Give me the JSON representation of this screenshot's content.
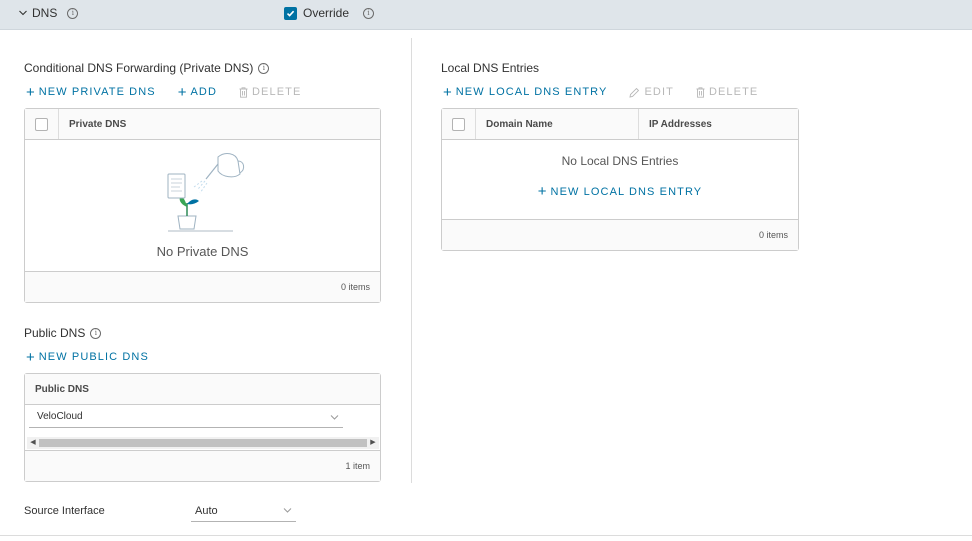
{
  "header": {
    "section_label": "DNS",
    "override_label": "Override",
    "override_checked": true,
    "accent_color": "#0072a3"
  },
  "conditional": {
    "title": "Conditional DNS Forwarding (Private DNS)",
    "actions": {
      "new_label": "NEW PRIVATE DNS",
      "add_label": "ADD",
      "delete_label": "DELETE"
    },
    "grid": {
      "column": "Private DNS",
      "empty_text": "No Private DNS",
      "footer": "0 items"
    }
  },
  "public": {
    "title": "Public DNS",
    "actions": {
      "new_label": "NEW PUBLIC DNS"
    },
    "grid": {
      "column": "Public DNS",
      "selected_value": "VeloCloud",
      "footer": "1 item"
    }
  },
  "source_interface": {
    "label": "Source Interface",
    "value": "Auto"
  },
  "local": {
    "title": "Local DNS Entries",
    "actions": {
      "new_label": "NEW LOCAL DNS ENTRY",
      "edit_label": "EDIT",
      "delete_label": "DELETE"
    },
    "grid": {
      "columns": [
        "Domain Name",
        "IP Addresses"
      ],
      "empty_text": "No Local DNS Entries",
      "empty_action": "NEW LOCAL DNS ENTRY",
      "footer": "0 items"
    }
  },
  "icons": [
    "chevron-down-icon",
    "info-icon",
    "checkbox-icon",
    "plus-icon",
    "trash-icon",
    "pencil-icon",
    "empty-state-illustration"
  ]
}
